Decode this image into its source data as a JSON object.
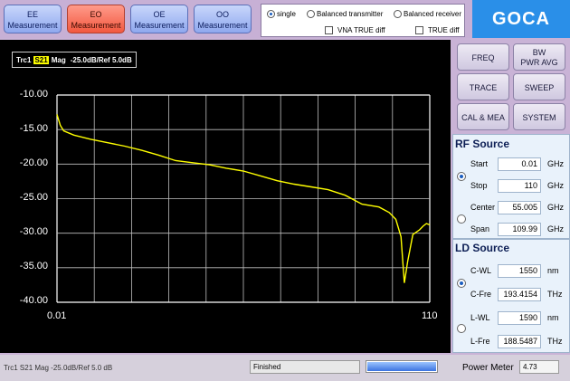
{
  "measurements": [
    {
      "top": "EE",
      "bottom": "Measurement",
      "active": false
    },
    {
      "top": "EO",
      "bottom": "Measurement",
      "active": true
    },
    {
      "top": "OE",
      "bottom": "Measurement",
      "active": false
    },
    {
      "top": "OO",
      "bottom": "Measurement",
      "active": false
    }
  ],
  "mode": {
    "single": "single",
    "balanced_transmitter": "Balanced transmitter",
    "balanced_receiver": "Balanced receiver",
    "vna_true_diff": "VNA TRUE  diff",
    "true_diff": "TRUE  diff"
  },
  "brand": "GOCA",
  "trace": {
    "trc": "Trc1",
    "param": "S21",
    "format": "Mag",
    "scale": "-25.0dB/Ref 5.0dB"
  },
  "chart_data": {
    "type": "line",
    "title": "",
    "xlabel": "",
    "ylabel": "",
    "xlim": [
      0.01,
      110
    ],
    "ylim": [
      -40,
      -10
    ],
    "x_tick_labels": [
      "0.01",
      "110"
    ],
    "y_tick_labels": [
      "-10.00",
      "-15.00",
      "-20.00",
      "-25.00",
      "-30.00",
      "-35.00",
      "-40.00"
    ],
    "grid": true,
    "series": [
      {
        "color": "#ffff00",
        "x": [
          0.01,
          0.5,
          1,
          2,
          5,
          10,
          15,
          20,
          25,
          30,
          35,
          40,
          45,
          50,
          55,
          60,
          65,
          70,
          75,
          80,
          85,
          90,
          95,
          98,
          100,
          101.5,
          102.5,
          103.5,
          105,
          107,
          108,
          109,
          110
        ],
        "y": [
          -12.8,
          -13.6,
          -14.4,
          -15.2,
          -15.8,
          -16.4,
          -16.9,
          -17.4,
          -18.0,
          -18.7,
          -19.5,
          -19.8,
          -20.1,
          -20.6,
          -21.0,
          -21.7,
          -22.4,
          -22.9,
          -23.3,
          -23.7,
          -24.5,
          -25.8,
          -26.2,
          -27.0,
          -28.0,
          -30.5,
          -37.2,
          -34.0,
          -30.2,
          -29.5,
          -29.0,
          -28.6,
          -28.8
        ]
      }
    ]
  },
  "side_buttons": {
    "freq": "FREQ",
    "bw_line1": "BW",
    "bw_line2": "PWR AVG",
    "trace": "TRACE",
    "sweep": "SWEEP",
    "calmea": "CAL & MEA",
    "system": "SYSTEM"
  },
  "rf_source": {
    "title": "RF Source",
    "start_label": "Start",
    "start_value": "0.01",
    "start_unit": "GHz",
    "stop_label": "Stop",
    "stop_value": "110",
    "stop_unit": "GHz",
    "center_label": "Center",
    "center_value": "55.005",
    "center_unit": "GHz",
    "span_label": "Span",
    "span_value": "109.99",
    "span_unit": "GHz"
  },
  "ld_source": {
    "title": "LD Source",
    "cwl_label": "C-WL",
    "cwl_value": "1550",
    "cwl_unit": "nm",
    "cfre_label": "C-Fre",
    "cfre_value": "193.4154",
    "cfre_unit": "THz",
    "lwl_label": "L-WL",
    "lwl_value": "1590",
    "lwl_unit": "nm",
    "lfre_label": "L-Fre",
    "lfre_value": "188.5487",
    "lfre_unit": "THz"
  },
  "status": {
    "trace_info": "Trc1 S21 Mag -25.0dB/Ref 5.0 dB",
    "state": "Finished",
    "power_meter_label": "Power Meter",
    "power_meter_value": "4.73",
    "progress": 1.0
  }
}
